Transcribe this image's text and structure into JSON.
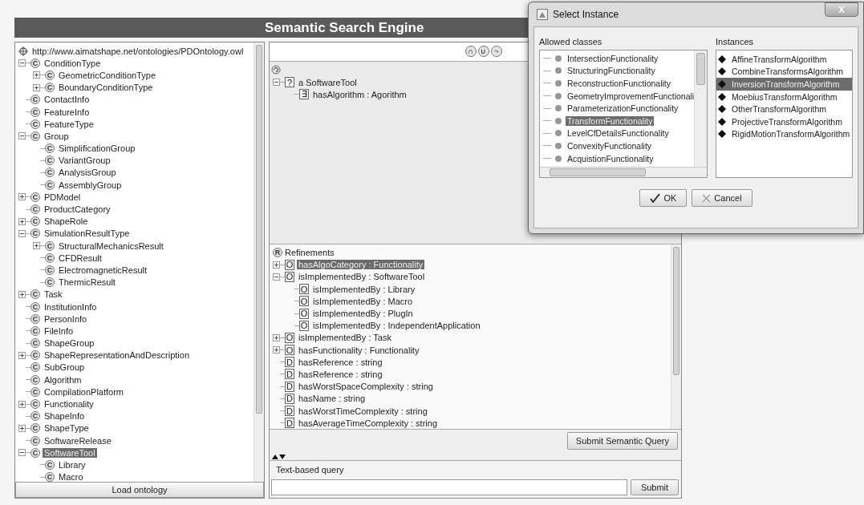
{
  "app": {
    "title": "Semantic Search Engine"
  },
  "ontology": {
    "root": {
      "label": "http://www.aimatshape.net/ontologies/PDOntology.owl",
      "selected": false,
      "children": [
        {
          "icon": "C",
          "label": "ConditionType",
          "expanded": true,
          "selected": false,
          "children": [
            {
              "icon": "C",
              "label": "GeometricConditionType",
              "expanded": false,
              "selected": false
            },
            {
              "icon": "C",
              "label": "BoundaryConditionType",
              "expanded": false,
              "selected": false
            }
          ]
        },
        {
          "icon": "C",
          "label": "ContactInfo",
          "selected": false
        },
        {
          "icon": "C",
          "label": "FeatureInfo",
          "selected": false
        },
        {
          "icon": "C",
          "label": "FeatureType",
          "selected": false
        },
        {
          "icon": "C",
          "label": "Group",
          "expanded": true,
          "selected": false,
          "children": [
            {
              "icon": "C",
              "label": "SimplificationGroup",
              "selected": false
            },
            {
              "icon": "C",
              "label": "VariantGroup",
              "selected": false
            },
            {
              "icon": "C",
              "label": "AnalysisGroup",
              "selected": false
            },
            {
              "icon": "C",
              "label": "AssemblyGroup",
              "selected": false
            }
          ]
        },
        {
          "icon": "C",
          "label": "PDModel",
          "expanded": false,
          "selected": false
        },
        {
          "icon": "C",
          "label": "ProductCategory",
          "selected": false
        },
        {
          "icon": "C",
          "label": "ShapeRole",
          "expanded": false,
          "selected": false
        },
        {
          "icon": "C",
          "label": "SimulationResultType",
          "expanded": true,
          "selected": false,
          "children": [
            {
              "icon": "C",
              "label": "StructuralMechanicsResult",
              "expanded": false,
              "selected": false
            },
            {
              "icon": "C",
              "label": "CFDResult",
              "selected": false
            },
            {
              "icon": "C",
              "label": "ElectromagneticResult",
              "selected": false
            },
            {
              "icon": "C",
              "label": "ThermicResult",
              "selected": false
            }
          ]
        },
        {
          "icon": "C",
          "label": "Task",
          "expanded": false,
          "selected": false
        },
        {
          "icon": "C",
          "label": "InstitutionInfo",
          "selected": false
        },
        {
          "icon": "C",
          "label": "PersonInfo",
          "selected": false
        },
        {
          "icon": "C",
          "label": "FileInfo",
          "selected": false
        },
        {
          "icon": "C",
          "label": "ShapeGroup",
          "selected": false
        },
        {
          "icon": "C",
          "label": "ShapeRepresentationAndDescription",
          "expanded": false,
          "selected": false
        },
        {
          "icon": "C",
          "label": "SubGroup",
          "selected": false
        },
        {
          "icon": "C",
          "label": "Algorithm",
          "selected": false
        },
        {
          "icon": "C",
          "label": "CompilationPlatform",
          "selected": false
        },
        {
          "icon": "C",
          "label": "Functionality",
          "expanded": false,
          "selected": false
        },
        {
          "icon": "C",
          "label": "ShapeInfo",
          "selected": false
        },
        {
          "icon": "C",
          "label": "ShapeType",
          "expanded": false,
          "selected": false
        },
        {
          "icon": "C",
          "label": "SoftwareRelease",
          "selected": false
        },
        {
          "icon": "C",
          "label": "SoftwareTool",
          "expanded": true,
          "selected": true,
          "children": [
            {
              "icon": "C",
              "label": "Library",
              "selected": false
            },
            {
              "icon": "C",
              "label": "Macro",
              "selected": false
            }
          ]
        }
      ]
    }
  },
  "load_button": "Load ontology",
  "query": {
    "operators": [
      "∩",
      "∪",
      "¬"
    ],
    "nodes": [
      {
        "icon": "?",
        "label": "a SoftwareTool",
        "expanded": true,
        "selected": false,
        "children": [
          {
            "icon": "∃",
            "label": "hasAlgorithm : Agorithm",
            "selected": false
          }
        ]
      }
    ]
  },
  "refinements": {
    "icon": "R",
    "title": "Refinements",
    "items": [
      {
        "icon": "O",
        "label": "hasAlgoCategory : Functionality",
        "expanded": false,
        "selected": true
      },
      {
        "icon": "O",
        "label": "isImplementedBy : SoftwareTool",
        "expanded": true,
        "selected": false,
        "children": [
          {
            "icon": "O",
            "label": "isImplementedBy : Library",
            "selected": false
          },
          {
            "icon": "O",
            "label": "isImplementedBy : Macro",
            "selected": false
          },
          {
            "icon": "O",
            "label": "isImplementedBy : PlugIn",
            "selected": false
          },
          {
            "icon": "O",
            "label": "isImplementedBy : IndependentApplication",
            "selected": false
          }
        ]
      },
      {
        "icon": "O",
        "label": "isImplementedBy : Task",
        "expanded": false,
        "selected": false
      },
      {
        "icon": "O",
        "label": "hasFunctionality : Functionality",
        "expanded": false,
        "selected": false
      },
      {
        "icon": "D",
        "label": "hasReference : string",
        "selected": false
      },
      {
        "icon": "D",
        "label": "hasReference : string",
        "selected": false
      },
      {
        "icon": "D",
        "label": "hasWorstSpaceComplexity : string",
        "selected": false
      },
      {
        "icon": "D",
        "label": "hasName : string",
        "selected": false
      },
      {
        "icon": "D",
        "label": "hasWorstTimeComplexity : string",
        "selected": false
      },
      {
        "icon": "D",
        "label": "hasAverageTimeComplexity : string",
        "selected": false
      }
    ]
  },
  "submit_semantic_button": "Submit Semantic Query",
  "text_query": {
    "label": "Text-based query",
    "submit_button": "Submit"
  },
  "dialog": {
    "title": "Select Instance",
    "close": "X",
    "allowed_classes": {
      "label": "Allowed classes",
      "items": [
        {
          "label": "IntersectionFunctionality",
          "selected": false
        },
        {
          "label": "StructuringFunctionality",
          "selected": false
        },
        {
          "label": "ReconstructionFunctionality",
          "selected": false
        },
        {
          "label": "GeometryImprovementFunctionali",
          "selected": false
        },
        {
          "label": "ParameterizationFunctionality",
          "selected": false
        },
        {
          "label": "TransformFunctionality",
          "selected": true
        },
        {
          "label": "LevelCfDetailsFunctionality",
          "selected": false
        },
        {
          "label": "ConvexityFunctionality",
          "selected": false
        },
        {
          "label": "AcquistionFunctionality",
          "selected": false
        }
      ]
    },
    "instances": {
      "label": "Instances",
      "items": [
        {
          "label": "AffineTransformAlgorithm",
          "selected": false
        },
        {
          "label": "CombineTransformsAlgorithm",
          "selected": false
        },
        {
          "label": "InversionTransformAlgorithm",
          "selected": true
        },
        {
          "label": "MoebiusTransformAlgorithm",
          "selected": false
        },
        {
          "label": "OtherTransformAlgorithm",
          "selected": false
        },
        {
          "label": "ProjectiveTransformAlgorithm",
          "selected": false
        },
        {
          "label": "RigidMotionTransformAlgorithm",
          "selected": false
        }
      ]
    },
    "ok_button": "OK",
    "cancel_button": "Cancel"
  }
}
